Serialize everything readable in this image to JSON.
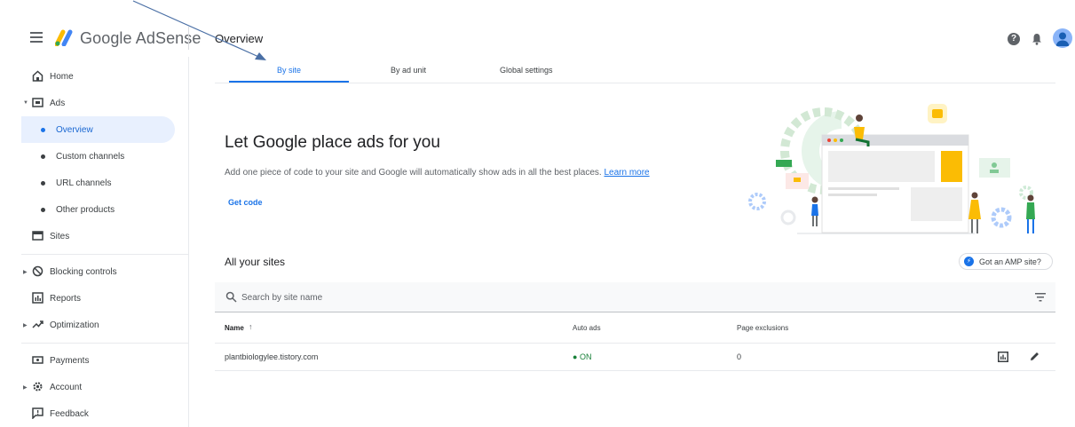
{
  "header": {
    "product_name": "Google AdSense",
    "page_title": "Overview",
    "help_glyph": "?"
  },
  "sidebar": {
    "items": [
      {
        "label": "Home",
        "icon": "home-icon"
      },
      {
        "label": "Ads",
        "icon": "ads-icon"
      },
      {
        "label": "Overview"
      },
      {
        "label": "Custom channels"
      },
      {
        "label": "URL channels"
      },
      {
        "label": "Other products"
      },
      {
        "label": "Sites",
        "icon": "sites-icon"
      },
      {
        "label": "Blocking controls",
        "icon": "block-icon"
      },
      {
        "label": "Reports",
        "icon": "reports-icon"
      },
      {
        "label": "Optimization",
        "icon": "trending-up-icon"
      },
      {
        "label": "Payments",
        "icon": "payments-icon"
      },
      {
        "label": "Account",
        "icon": "gear-icon"
      },
      {
        "label": "Feedback",
        "icon": "feedback-icon"
      }
    ]
  },
  "tabs": [
    {
      "label": "By site"
    },
    {
      "label": "By ad unit"
    },
    {
      "label": "Global settings"
    }
  ],
  "hero": {
    "title": "Let Google place ads for you",
    "description": "Add one piece of code to your site and Google will automatically show ads in all the best places.",
    "learn_more": "Learn more",
    "get_code": "Get code"
  },
  "sites": {
    "title": "All your sites",
    "amp_button": "Got an AMP site?",
    "search_placeholder": "Search by site name",
    "columns": {
      "name": "Name",
      "auto_ads": "Auto ads",
      "page_exclusions": "Page exclusions"
    },
    "rows": [
      {
        "site": "plantbiologylee.tistory.com",
        "auto_ads": "ON",
        "page_exclusions": "0"
      }
    ]
  },
  "colors": {
    "accent": "#1a73e8",
    "active_nav_bg": "#e8f0fe",
    "status_on": "#188038",
    "annotation_arrow": "#4a6fa5"
  }
}
